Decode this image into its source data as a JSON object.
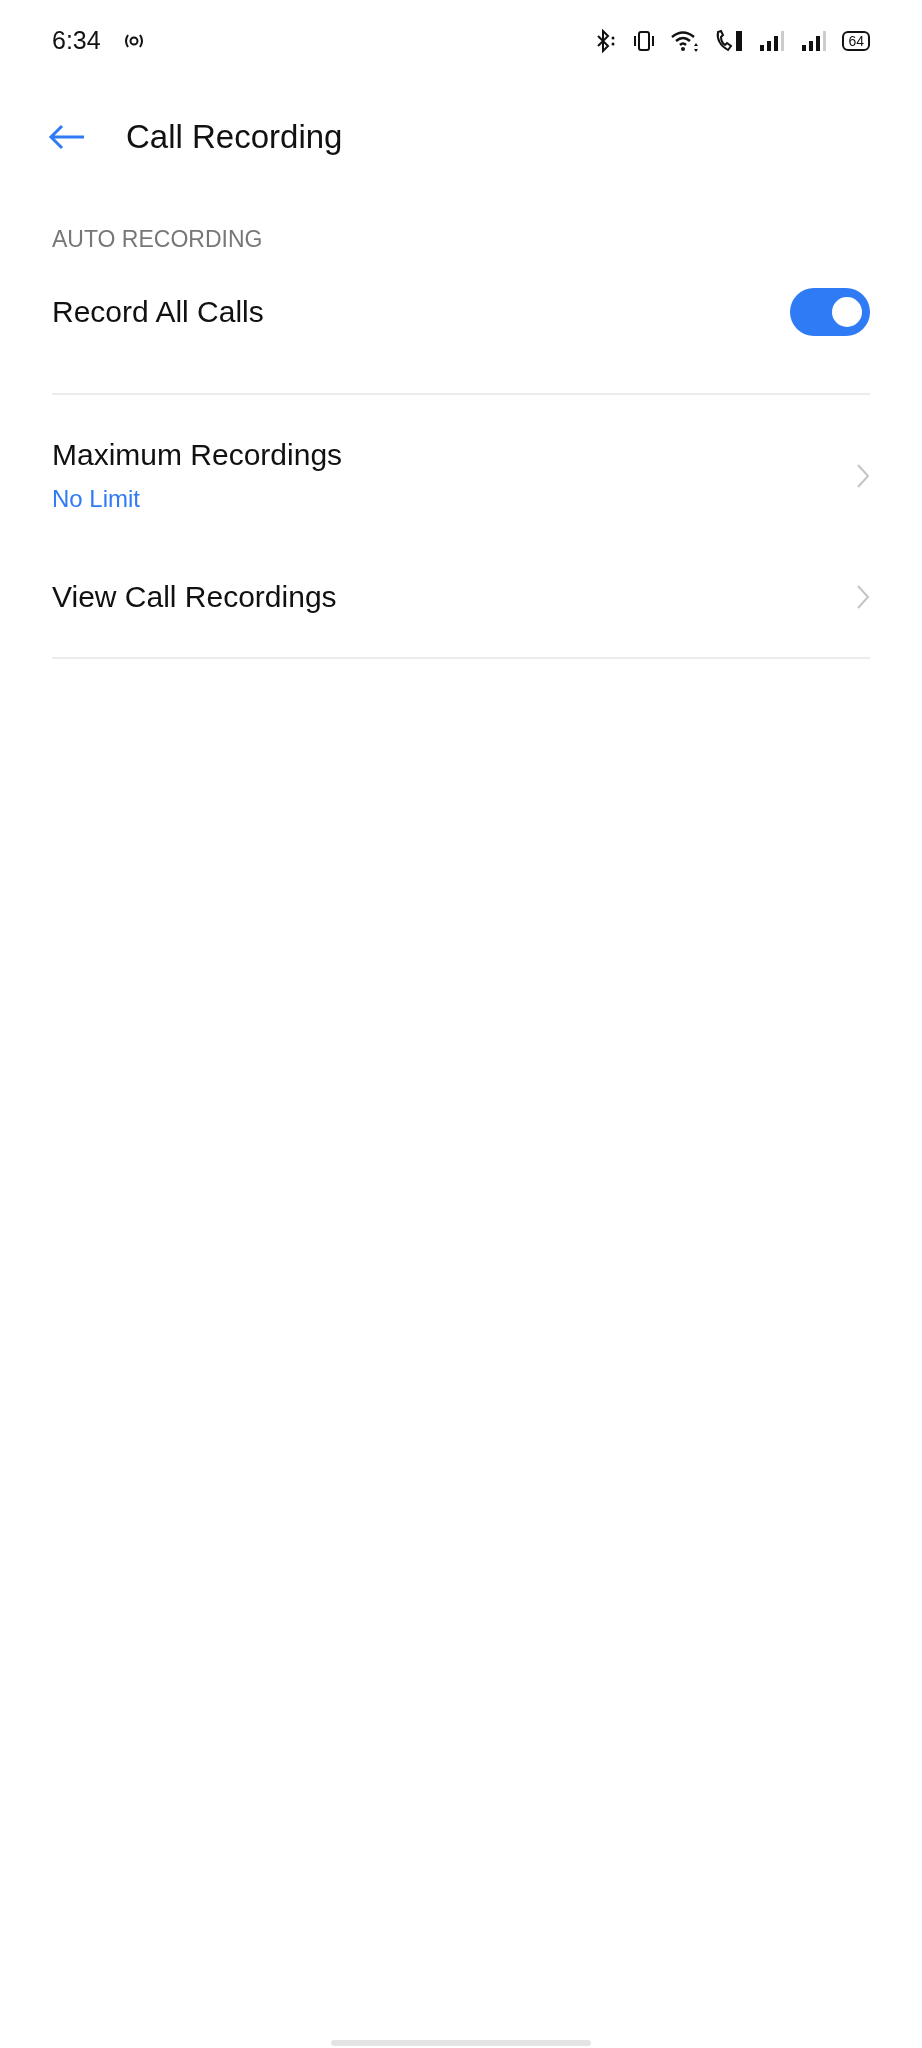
{
  "status_bar": {
    "time": "6:34",
    "battery": "64"
  },
  "header": {
    "title": "Call Recording"
  },
  "sections": [
    {
      "title": "AUTO RECORDING",
      "items": [
        {
          "kind": "toggle",
          "label": "Record All Calls",
          "on": true
        }
      ]
    },
    {
      "items": [
        {
          "kind": "link",
          "label": "Maximum Recordings",
          "value": "No Limit"
        },
        {
          "kind": "link",
          "label": "View Call Recordings"
        }
      ]
    }
  ]
}
